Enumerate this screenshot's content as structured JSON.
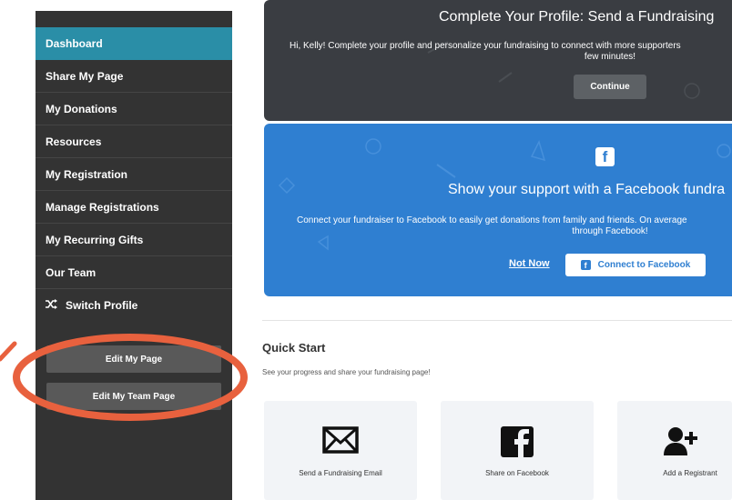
{
  "sidebar": {
    "items": [
      {
        "label": "Dashboard"
      },
      {
        "label": "Share My Page"
      },
      {
        "label": "My Donations"
      },
      {
        "label": "Resources"
      },
      {
        "label": "My Registration"
      },
      {
        "label": "Manage Registrations"
      },
      {
        "label": "My Recurring Gifts"
      },
      {
        "label": "Our Team"
      },
      {
        "label": "Switch Profile",
        "icon": "shuffle-icon"
      }
    ],
    "active": "Dashboard",
    "edit_page_label": "Edit My Page",
    "edit_team_label": "Edit My Team Page"
  },
  "profile_banner": {
    "title": "Complete Your Profile: Send a Fundraising",
    "text_line1": "Hi, Kelly! Complete your profile and personalize your fundraising to connect with more supporters",
    "text_line2": "few minutes!",
    "button_label": "Continue"
  },
  "facebook_banner": {
    "icon": "facebook-icon",
    "title": "Show your support with a Facebook fundra",
    "text_line1": "Connect your fundraiser to Facebook to easily get donations from family and friends. On average",
    "text_line2": "through Facebook!",
    "not_now_label": "Not Now",
    "connect_label": "Connect to Facebook"
  },
  "quick_start": {
    "title": "Quick Start",
    "subtitle": "See your progress and share your fundraising page!",
    "cards": [
      {
        "label": "Send a Fundraising Email",
        "icon": "envelope-icon"
      },
      {
        "label": "Share on Facebook",
        "icon": "facebook-icon"
      },
      {
        "label": "Add a Registrant",
        "icon": "add-user-icon"
      }
    ]
  },
  "colors": {
    "sidebar_bg": "#333333",
    "active_item": "#2a8ea7",
    "facebook_blue": "#2f7fd1",
    "highlight": "#e8613e"
  }
}
